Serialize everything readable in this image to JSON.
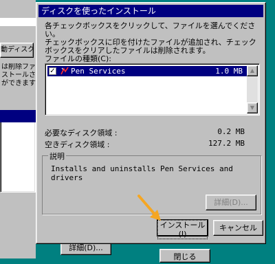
{
  "background_window": {
    "tab_label": "動ディスク",
    "text": "は削除ファ\nストールされ\nができます",
    "details_button": "詳細(D)...",
    "close_button": "閉じる"
  },
  "dialog": {
    "title": "ディスクを使ったインストール",
    "instructions": "各チェックボックスをクリックして、ファイルを選んでください。\nチェックボックスに印を付けたファイルが追加され、チェックボックスをクリアしたファイルは削除されます。",
    "file_types_label": "ファイルの種類(C):",
    "files": [
      {
        "name": "Pen Services",
        "size": "1.0 MB",
        "checked": true
      }
    ],
    "required_space_label": "必要なディスク領域 :",
    "required_space_value": "0.2 MB",
    "free_space_label": "空きディスク領域 :",
    "free_space_value": "127.2 MB",
    "description_legend": "説明",
    "description_text": "Installs and uninstalls Pen Services and drivers",
    "details_button": "詳細(D)...",
    "install_button": "インストール(I)",
    "cancel_button": "キャンセル"
  },
  "colors": {
    "desktop": "#008080",
    "face": "#c0c0c0",
    "titlebar": "#000080",
    "pointer_arrow": "#f5a623"
  }
}
